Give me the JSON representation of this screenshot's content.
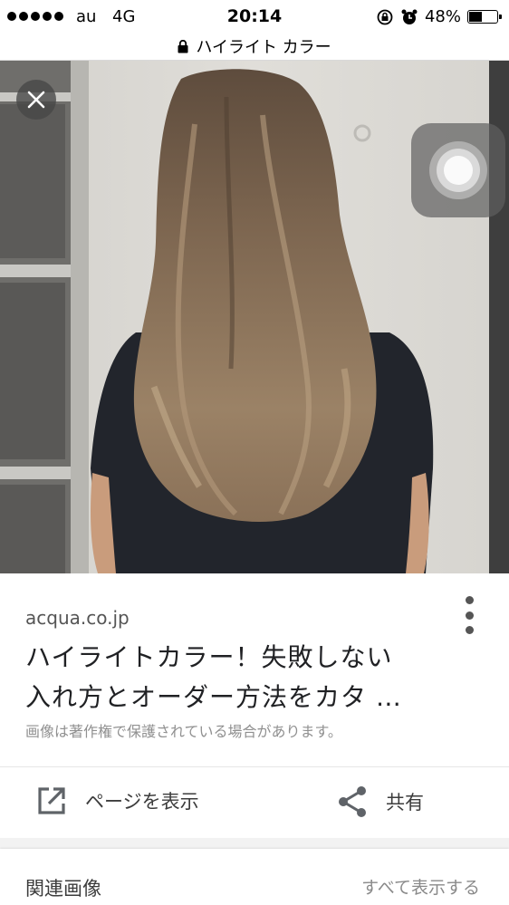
{
  "status_bar": {
    "carrier": "au",
    "network": "4G",
    "time": "20:14",
    "battery": "48%",
    "battery_level": 0.48,
    "signal_bars": 5
  },
  "url_bar": {
    "title": "ハイライト カラー",
    "lock_icon": "lock-icon"
  },
  "viewer": {
    "close_icon": "close-icon",
    "assistive_touch_icon": "assistive-touch-icon"
  },
  "result": {
    "site": "acqua.co.jp",
    "title_line1": "ハイライトカラー！失敗しない",
    "title_line2": "入れ方とオーダー方法をカタ …",
    "notice": "画像は著作権で保護されている場合があります。",
    "more_icon": "more-vert-icon"
  },
  "actions": {
    "visit_label": "ページを表示",
    "share_label": "共有"
  },
  "related": {
    "title": "関連画像",
    "see_all": "すべて表示する"
  },
  "colors": {
    "text_primary": "#202124",
    "text_secondary": "#555555",
    "notice": "#909090",
    "divider": "#e6e6e6"
  }
}
